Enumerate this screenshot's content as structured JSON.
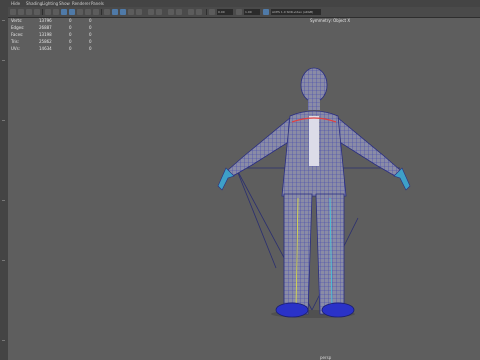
{
  "menu": [
    "Hide",
    "Shading",
    "Lighting",
    "Show",
    "Renderer",
    "Panels"
  ],
  "toolbar": {
    "fields": [
      "0.00",
      "1.00",
      "ACES 1.0 SDR-video (sRGB)"
    ]
  },
  "hud": {
    "rows": [
      {
        "label": "Verts:",
        "values": [
          "13796",
          "0",
          "0"
        ]
      },
      {
        "label": "Edges:",
        "values": [
          "26887",
          "0",
          "0"
        ]
      },
      {
        "label": "Faces:",
        "values": [
          "13198",
          "0",
          "0"
        ]
      },
      {
        "label": "Tris:",
        "values": [
          "25862",
          "0",
          "0"
        ]
      },
      {
        "label": "UVs:",
        "values": [
          "14634",
          "0",
          "0"
        ]
      }
    ],
    "symmetry": "Symmetry: Object X",
    "camera": "persp"
  },
  "model": {
    "wire_color": "#3a3fb0",
    "fill_color": "#8a8ca6",
    "accent_colors": [
      "#e0e040",
      "#40c8e0",
      "#e04040"
    ]
  }
}
